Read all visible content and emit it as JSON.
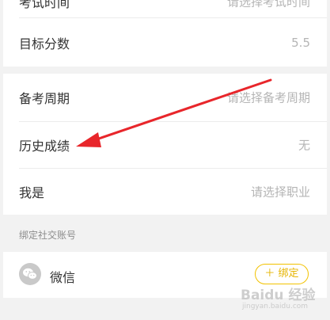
{
  "rows": {
    "top_partial": {
      "label": "考试时间",
      "value": "请选择考试时间"
    },
    "target_score": {
      "label": "目标分数",
      "value": "5.5"
    },
    "prep_period": {
      "label": "备考周期",
      "value": "请选择备考周期"
    },
    "history_scores": {
      "label": "历史成绩",
      "value": "无"
    },
    "occupation": {
      "label": "我是",
      "value": "请选择职业"
    }
  },
  "social": {
    "section_title": "绑定社交账号",
    "wechat_label": "微信",
    "wechat_icon": "wechat-icon",
    "bind_label": "＋ 绑定"
  },
  "annotation": {
    "arrow_color": "#e8262b",
    "points_to": "历史成绩"
  },
  "watermark": {
    "text": "Baidu 经验",
    "url": "jingyan.baidu.com"
  },
  "colors": {
    "accent": "#f2c200",
    "background": "#f2f2f2"
  }
}
